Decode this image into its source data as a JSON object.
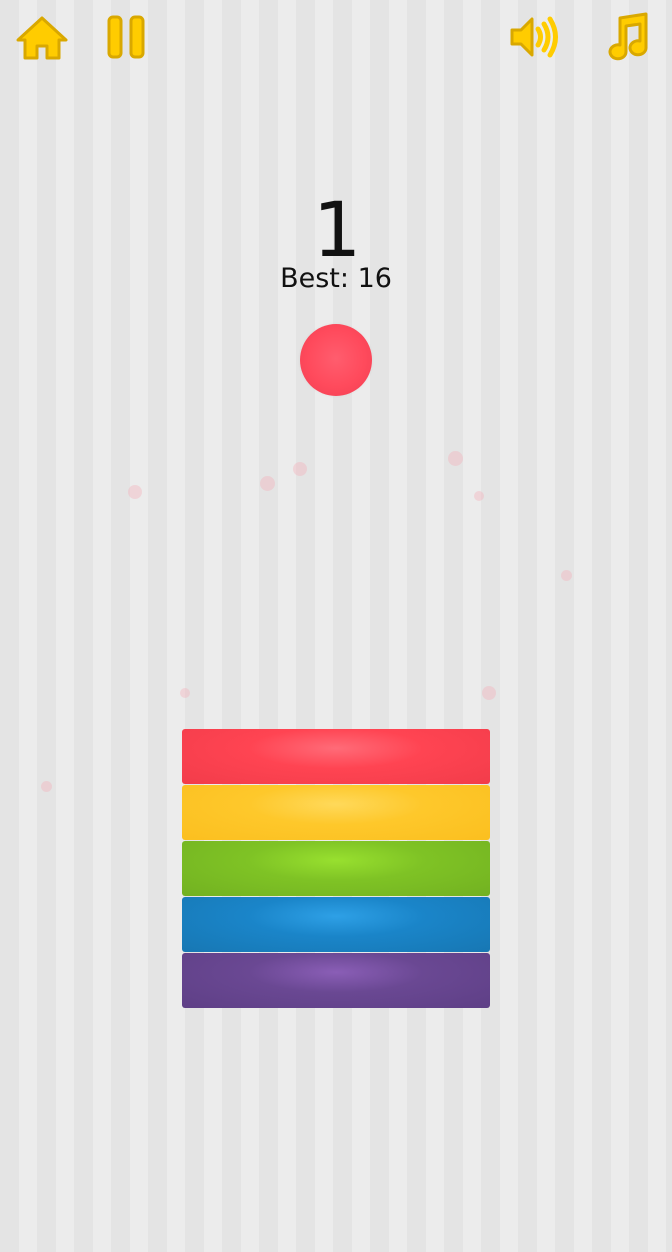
{
  "toolbar": {
    "home": {
      "icon": "home-icon"
    },
    "pause": {
      "icon": "pause-icon"
    },
    "sound": {
      "icon": "speaker-volume-icon"
    },
    "music": {
      "icon": "music-note-icon"
    }
  },
  "score": {
    "current": "1",
    "best_label": "Best:",
    "best_value": "16"
  },
  "ball": {
    "color": "#ff4a5c"
  },
  "stack": {
    "bars": [
      {
        "color_name": "red",
        "color": "#ff4452"
      },
      {
        "color_name": "yellow",
        "color": "#fec82b"
      },
      {
        "color_name": "green",
        "color": "#7fc325"
      },
      {
        "color_name": "blue",
        "color": "#1a85c9"
      },
      {
        "color_name": "purple",
        "color": "#6a4893"
      }
    ]
  },
  "colors": {
    "icon": "#ffcc00",
    "icon_outline": "#d9a800",
    "background_light": "#ececec",
    "background_dark": "#e4e4e4",
    "text": "#111111"
  }
}
